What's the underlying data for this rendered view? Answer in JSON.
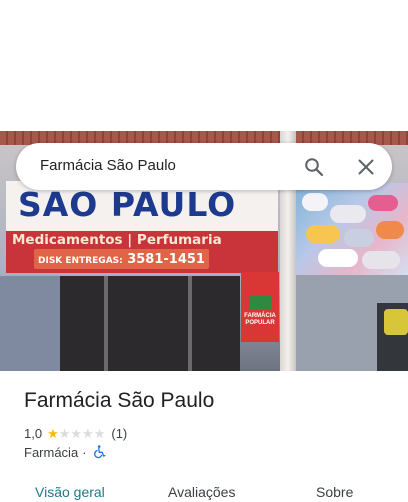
{
  "search": {
    "query": "Farmácia São Paulo"
  },
  "photo": {
    "sign_name": "SAO PAULO",
    "sign_subtitle": "Medicamentos | Perfumaria",
    "sign_disk_label": "DISK ENTREGAS:",
    "sign_disk_phone": "3581-1451",
    "popular_sign": "FARMÁCIA POPULAR"
  },
  "place": {
    "title": "Farmácia São Paulo",
    "rating": "1,0",
    "stars_filled": 1,
    "stars_total": 5,
    "review_count": "(1)",
    "category": "Farmácia",
    "separator": "·"
  },
  "tabs": [
    {
      "label": "Visão geral",
      "active": true
    },
    {
      "label": "Avaliações",
      "active": false
    },
    {
      "label": "Sobre",
      "active": false
    }
  ],
  "colors": {
    "accent": "#1a7a88",
    "star": "#fbbc04",
    "wheelchair": "#1a73e8"
  },
  "icons": {
    "search": "search-icon",
    "close": "close-icon",
    "accessibility": "wheelchair-icon"
  }
}
